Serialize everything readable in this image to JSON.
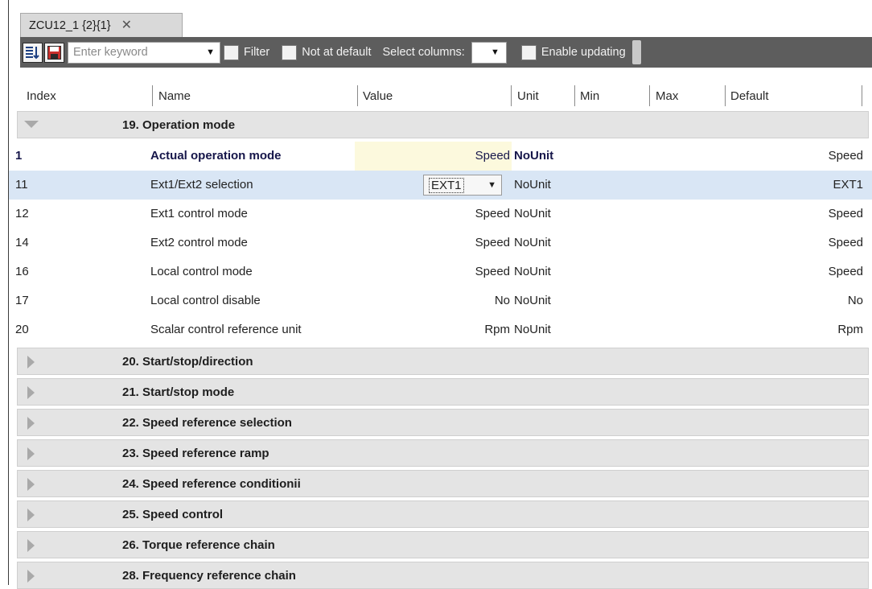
{
  "tab": {
    "title": "ZCU12_1 {2}{1}",
    "close": "✕"
  },
  "toolbar": {
    "keyword_placeholder": "Enter keyword",
    "filter": "Filter",
    "not_at_default": "Not at default",
    "select_columns": "Select columns:",
    "enable_updating": "Enable updating"
  },
  "columns": [
    "Index",
    "Name",
    "Value",
    "Unit",
    "Min",
    "Max",
    "Default"
  ],
  "open_group": "19. Operation mode",
  "rows": [
    {
      "index": "1",
      "name": "Actual operation mode",
      "value": "Speed",
      "unit": "NoUnit",
      "default": "Speed"
    },
    {
      "index": "11",
      "name": "Ext1/Ext2 selection",
      "value": "EXT1",
      "unit": "NoUnit",
      "default": "EXT1"
    },
    {
      "index": "12",
      "name": "Ext1 control mode",
      "value": "Speed",
      "unit": "NoUnit",
      "default": "Speed"
    },
    {
      "index": "14",
      "name": "Ext2 control mode",
      "value": "Speed",
      "unit": "NoUnit",
      "default": "Speed"
    },
    {
      "index": "16",
      "name": "Local control mode",
      "value": "Speed",
      "unit": "NoUnit",
      "default": "Speed"
    },
    {
      "index": "17",
      "name": "Local control disable",
      "value": "No",
      "unit": "NoUnit",
      "default": "No"
    },
    {
      "index": "20",
      "name": "Scalar control reference unit",
      "value": "Rpm",
      "unit": "NoUnit",
      "default": "Rpm"
    }
  ],
  "groups": [
    "20. Start/stop/direction",
    "21. Start/stop mode",
    "22. Speed reference selection",
    "23. Speed reference ramp",
    "24. Speed reference conditionii",
    "25. Speed control",
    "26. Torque reference chain",
    "28. Frequency reference chain"
  ]
}
